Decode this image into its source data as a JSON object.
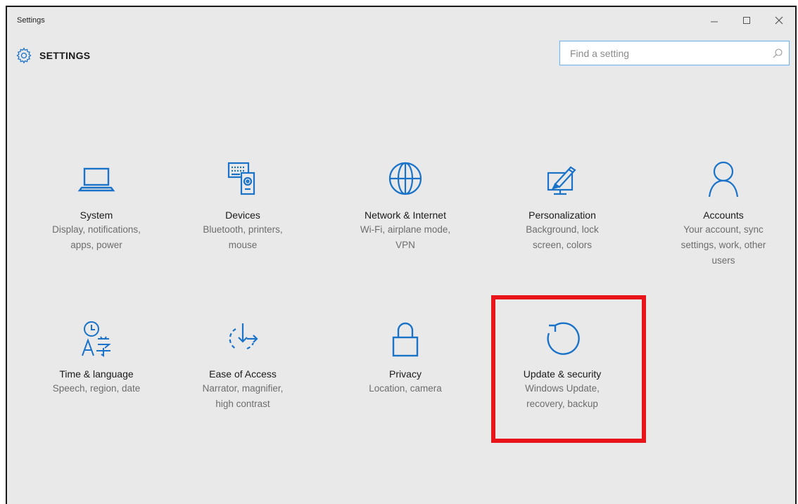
{
  "window": {
    "title": "Settings"
  },
  "header": {
    "title": "SETTINGS",
    "icon": "gear-icon"
  },
  "search": {
    "placeholder": "Find a setting",
    "value": ""
  },
  "controls": {
    "minimize": "minimize-icon",
    "maximize": "maximize-icon",
    "close": "close-icon"
  },
  "tiles": [
    {
      "title": "System",
      "desc1": "Display, notifications,",
      "desc2": "apps, power",
      "desc3": "",
      "icon": "laptop-icon"
    },
    {
      "title": "Devices",
      "desc1": "Bluetooth, printers,",
      "desc2": "mouse",
      "desc3": "",
      "icon": "devices-icon"
    },
    {
      "title": "Network & Internet",
      "desc1": "Wi-Fi, airplane mode,",
      "desc2": "VPN",
      "desc3": "",
      "icon": "globe-icon"
    },
    {
      "title": "Personalization",
      "desc1": "Background, lock",
      "desc2": "screen, colors",
      "desc3": "",
      "icon": "paint-icon"
    },
    {
      "title": "Accounts",
      "desc1": "Your account, sync",
      "desc2": "settings, work, other",
      "desc3": "users",
      "icon": "person-icon"
    },
    {
      "title": "Time & language",
      "desc1": "Speech, region, date",
      "desc2": "",
      "desc3": "",
      "icon": "time-language-icon"
    },
    {
      "title": "Ease of Access",
      "desc1": "Narrator, magnifier,",
      "desc2": "high contrast",
      "desc3": "",
      "icon": "ease-of-access-icon"
    },
    {
      "title": "Privacy",
      "desc1": "Location, camera",
      "desc2": "",
      "desc3": "",
      "icon": "lock-icon"
    },
    {
      "title": "Update & security",
      "desc1": "Windows Update,",
      "desc2": "recovery, backup",
      "desc3": "",
      "icon": "refresh-icon"
    }
  ],
  "colors": {
    "accent": "#1a73c8",
    "background": "#e9e9e9",
    "highlight": "#e8141a"
  }
}
